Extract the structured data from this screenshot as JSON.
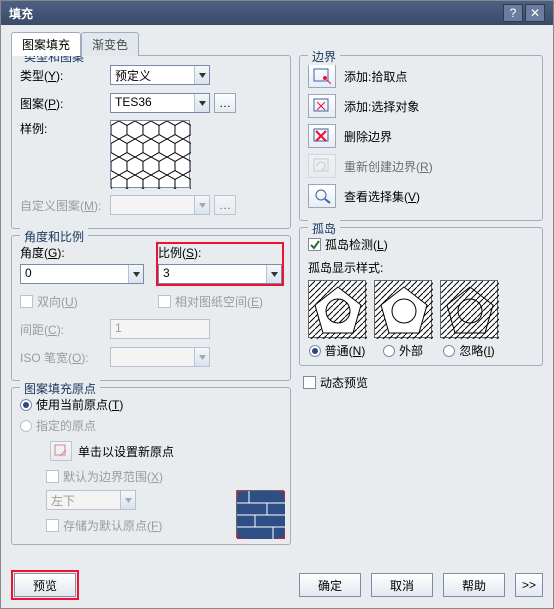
{
  "title": "填充",
  "tabs": {
    "active": "图案填充",
    "inactive": "渐变色"
  },
  "typeGroup": {
    "title": "类型和图案",
    "typeLabel": "类型",
    "typeKey": "Y",
    "typeValue": "预定义",
    "patternLabel": "图案",
    "patternKey": "P",
    "patternValue": "TES36",
    "sampleLabel": "样例:",
    "customLabel": "自定义图案",
    "customKey": "M"
  },
  "angleGroup": {
    "title": "角度和比例",
    "angleLabel": "角度",
    "angleKey": "G",
    "angleValue": "0",
    "scaleLabel": "比例",
    "scaleKey": "S",
    "scaleValue": "3",
    "doubleLabel": "双向",
    "doubleKey": "U",
    "paperLabel": "相对图纸空间",
    "paperKey": "E",
    "spacingLabel": "间距",
    "spacingKey": "C",
    "spacingValue": "1",
    "isoLabel": "ISO 笔宽",
    "isoKey": "O"
  },
  "originGroup": {
    "title": "图案填充原点",
    "useCurrent": "使用当前原点",
    "useCurrentKey": "T",
    "specified": "指定的原点",
    "clickNew": "单击以设置新原点",
    "defaultBoundary": "默认为边界范围",
    "defaultBoundaryKey": "X",
    "positionValue": "左下",
    "storeDefault": "存储为默认原点",
    "storeDefaultKey": "F"
  },
  "boundaryGroup": {
    "title": "边界",
    "addPick": "添加:拾取点",
    "addSelect": "添加:选择对象",
    "removeBoundary": "删除边界",
    "recreateBoundary": "重新创建边界",
    "recreateKey": "R",
    "viewSelection": "查看选择集",
    "viewSelectionKey": "V"
  },
  "islandGroup": {
    "title": "孤岛",
    "detect": "孤岛检测",
    "detectKey": "L",
    "styleLabel": "孤岛显示样式:",
    "normal": "普通",
    "normalKey": "N",
    "outer": "外部",
    "ignore": "忽略",
    "ignoreKey": "I"
  },
  "dynamicPreview": "动态预览",
  "buttons": {
    "preview": "预览",
    "ok": "确定",
    "cancel": "取消",
    "help": "帮助",
    "expand": ">>"
  }
}
